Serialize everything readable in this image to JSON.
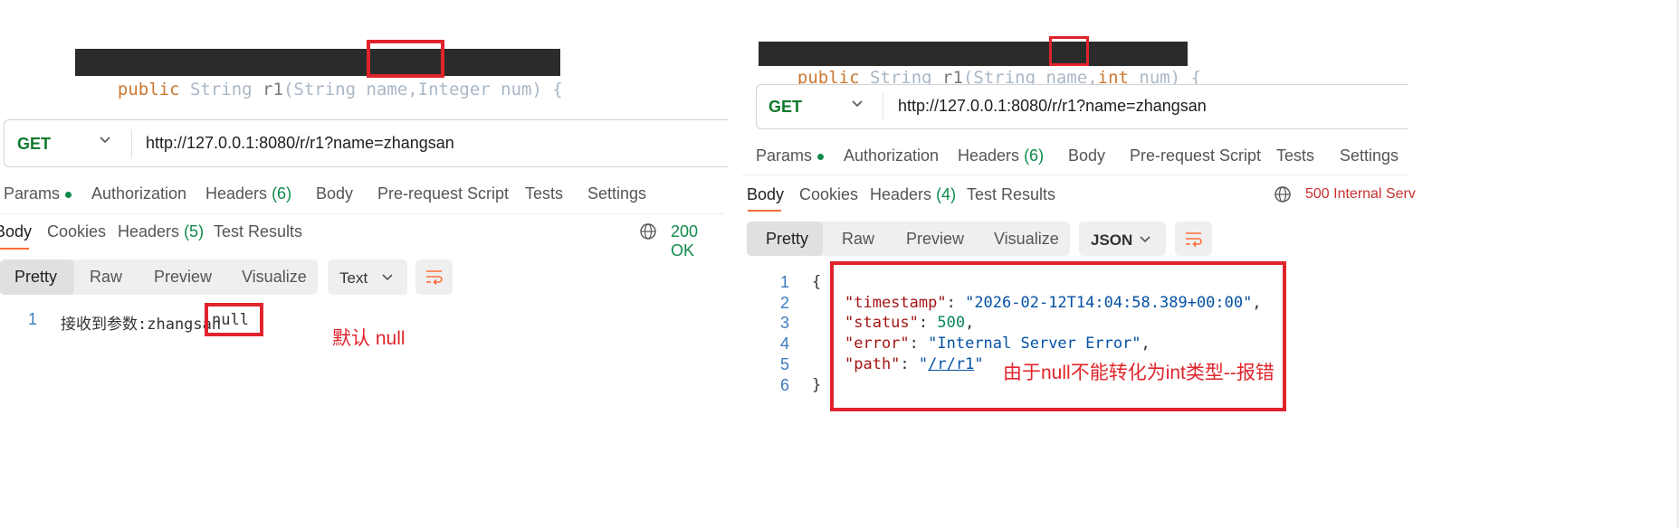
{
  "left": {
    "code": {
      "kw": "public",
      "t1": " String ",
      "fn": "r1",
      "t2": "(String name,",
      "hl": "Integer",
      "t3": " num) {"
    },
    "request": {
      "method": "GET",
      "url": "http://127.0.0.1:8080/r/r1?name=zhangsan"
    },
    "req_tabs": {
      "params": "Params",
      "auth": "Authorization",
      "headers": "Headers",
      "headers_count": "(6)",
      "body": "Body",
      "prereq": "Pre-request Script",
      "tests": "Tests",
      "settings": "Settings"
    },
    "resp_tabs": {
      "body": "Body",
      "cookies": "Cookies",
      "headers": "Headers",
      "headers_count": "(5)",
      "test_results": "Test Results"
    },
    "status": "200 OK",
    "view": {
      "pretty": "Pretty",
      "raw": "Raw",
      "preview": "Preview",
      "visualize": "Visualize",
      "format": "Text"
    },
    "response": {
      "line": "1",
      "text": "接收到参数:zhangsan",
      "value": "null"
    },
    "annotation": "默认 null"
  },
  "right": {
    "code": {
      "kw": "public",
      "t1": " String ",
      "fn": "r1",
      "t2": "(String name,",
      "hl": "int",
      "t3": " num) {"
    },
    "request": {
      "method": "GET",
      "url": "http://127.0.0.1:8080/r/r1?name=zhangsan"
    },
    "req_tabs": {
      "params": "Params",
      "auth": "Authorization",
      "headers": "Headers",
      "headers_count": "(6)",
      "body": "Body",
      "prereq": "Pre-request Script",
      "tests": "Tests",
      "settings": "Settings"
    },
    "resp_tabs": {
      "body": "Body",
      "cookies": "Cookies",
      "headers": "Headers",
      "headers_count": "(4)",
      "test_results": "Test Results"
    },
    "status": "500 Internal Serv",
    "view": {
      "pretty": "Pretty",
      "raw": "Raw",
      "preview": "Preview",
      "visualize": "Visualize",
      "format": "JSON"
    },
    "response": {
      "line_numbers": [
        "1",
        "2",
        "3",
        "4",
        "5",
        "6"
      ],
      "open": "{",
      "close": "}",
      "timestamp_key": "\"timestamp\"",
      "timestamp_val": "\"2026-02-12T14:04:58.389+00:00\"",
      "status_key": "\"status\"",
      "status_val": "500",
      "error_key": "\"error\"",
      "error_val": "\"Internal Server Error\"",
      "path_key": "\"path\"",
      "path_q": "\"",
      "path_val": "/r/r1"
    },
    "annotation": "由于null不能转化为int类型--报错"
  },
  "colors": {
    "accent": "#ff6c37",
    "method": "#0f7a2e",
    "ok": "#0f8a4a",
    "error": "#c6312f",
    "highlight": "#e0242c"
  },
  "icons": {
    "globe": "globe-icon",
    "chevron": "chevron-down-icon",
    "wrap": "wrap-lines-icon"
  }
}
